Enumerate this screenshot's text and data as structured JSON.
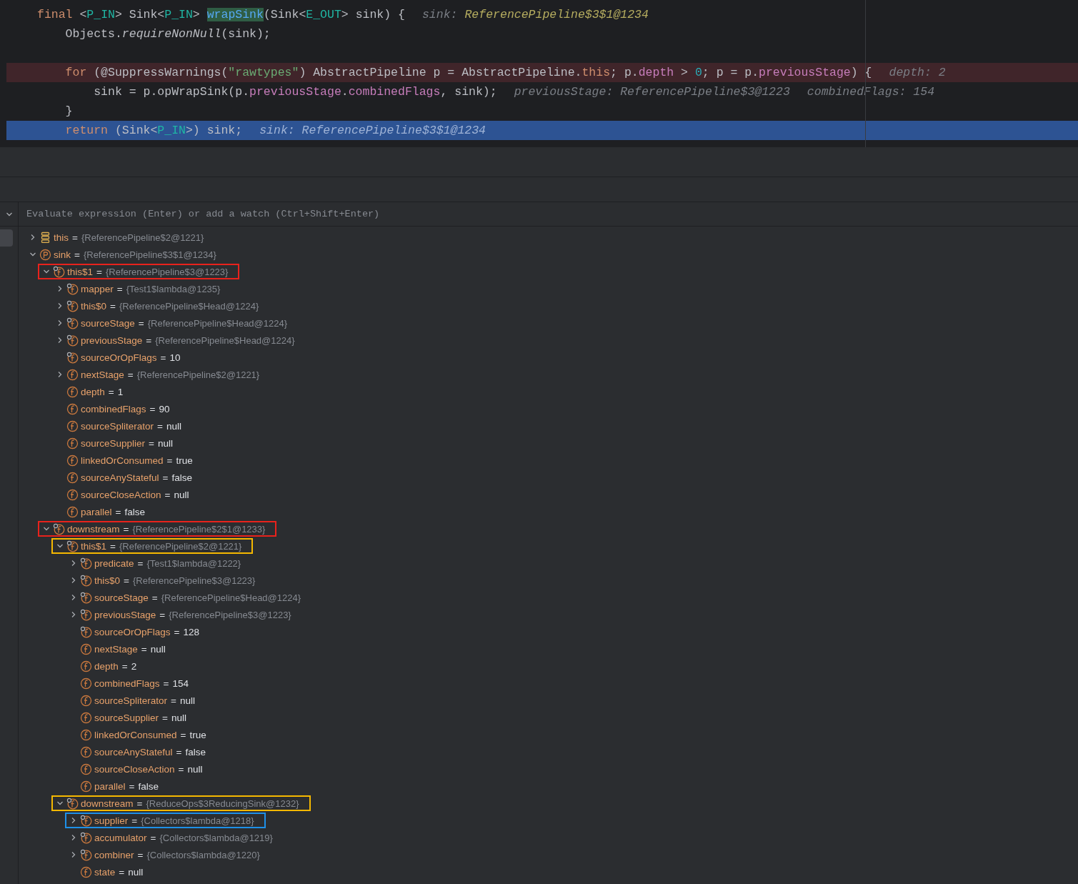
{
  "editor": {
    "lines": [
      {
        "kind": "none",
        "tokens": [
          {
            "kind": "keyword",
            "text": "final "
          },
          {
            "kind": "plain",
            "text": "<"
          },
          {
            "kind": "type-param",
            "text": "P_IN"
          },
          {
            "kind": "plain",
            "text": "> Sink<"
          },
          {
            "kind": "type-param",
            "text": "P_IN"
          },
          {
            "kind": "plain",
            "text": "> "
          },
          {
            "kind": "method-decl",
            "text": "wrapSink"
          },
          {
            "kind": "plain",
            "text": "(Sink<"
          },
          {
            "kind": "type-param",
            "text": "E_OUT"
          },
          {
            "kind": "plain",
            "text": "> sink) {"
          },
          {
            "kind": "hint",
            "text": "sink:"
          },
          {
            "kind": "hint-changed",
            "text": "ReferencePipeline$3$1@1234"
          }
        ]
      },
      {
        "kind": "none",
        "tokens": [
          {
            "kind": "plain",
            "text": "    Objects."
          },
          {
            "kind": "italic",
            "text": "requireNonNull"
          },
          {
            "kind": "plain",
            "text": "(sink);"
          }
        ]
      },
      {
        "kind": "none"
      },
      {
        "kind": "breakpoint",
        "tokens": [
          {
            "kind": "keyword",
            "text": "    for "
          },
          {
            "kind": "plain",
            "text": "(@SuppressWarnings("
          },
          {
            "kind": "string",
            "text": "\"rawtypes\""
          },
          {
            "kind": "plain",
            "text": ") AbstractPipeline p = AbstractPipeline."
          },
          {
            "kind": "keyword",
            "text": "this"
          },
          {
            "kind": "plain",
            "text": "; p."
          },
          {
            "kind": "field",
            "text": "depth"
          },
          {
            "kind": "plain",
            "text": " > "
          },
          {
            "kind": "number",
            "text": "0"
          },
          {
            "kind": "plain",
            "text": "; p = p."
          },
          {
            "kind": "field",
            "text": "previousStage"
          },
          {
            "kind": "plain",
            "text": ") {"
          },
          {
            "kind": "hint",
            "text": "depth: 2"
          }
        ]
      },
      {
        "kind": "none",
        "tokens": [
          {
            "kind": "plain",
            "text": "        sink = p.opWrapSink(p."
          },
          {
            "kind": "field",
            "text": "previousStage"
          },
          {
            "kind": "plain",
            "text": "."
          },
          {
            "kind": "field",
            "text": "combinedFlags"
          },
          {
            "kind": "plain",
            "text": ", sink);"
          },
          {
            "kind": "hint",
            "text": "previousStage: ReferencePipeline$3@1223"
          },
          {
            "kind": "hint",
            "text": "combinedFlags: 154"
          }
        ]
      },
      {
        "kind": "none",
        "tokens": [
          {
            "kind": "plain",
            "text": "    }"
          }
        ]
      },
      {
        "kind": "current",
        "tokens": [
          {
            "kind": "keyword",
            "text": "    return "
          },
          {
            "kind": "plain",
            "text": "(Sink<"
          },
          {
            "kind": "type-param",
            "text": "P_IN"
          },
          {
            "kind": "plain",
            "text": ">) sink;"
          },
          {
            "kind": "hint",
            "text": "sink: ReferencePipeline$3$1@1234"
          }
        ]
      }
    ]
  },
  "evaluate": {
    "placeholder": "Evaluate expression (Enter) or add a watch (Ctrl+Shift+Enter)"
  },
  "variables": [
    {
      "kind": "stack",
      "name": "this",
      "eq": "=",
      "value": "{ReferencePipeline$2@1221}",
      "expanded": false
    },
    {
      "kind": "parameter",
      "name": "sink",
      "eq": "=",
      "value": "{ReferencePipeline$3$1@1234}",
      "expanded": true,
      "children": [
        {
          "kind": "final-field",
          "name": "this$1",
          "eq": "=",
          "value": "{ReferencePipeline$3@1223}",
          "expanded": true,
          "color": "#e8221c",
          "children": [
            {
              "kind": "final-field",
              "name": "mapper",
              "eq": "=",
              "value": "{Test1$lambda@1235}",
              "expanded": false
            },
            {
              "kind": "final-field",
              "name": "this$0",
              "eq": "=",
              "value": "{ReferencePipeline$Head@1224}",
              "expanded": false
            },
            {
              "kind": "final-field",
              "name": "sourceStage",
              "eq": "=",
              "value": "{ReferencePipeline$Head@1224}",
              "expanded": false
            },
            {
              "kind": "final-field",
              "name": "previousStage",
              "eq": "=",
              "value": "{ReferencePipeline$Head@1224}",
              "expanded": false
            },
            {
              "kind": "final-field",
              "name": "sourceOrOpFlags",
              "eq": "=",
              "value": "10"
            },
            {
              "kind": "field",
              "name": "nextStage",
              "eq": "=",
              "value": "{ReferencePipeline$2@1221}",
              "expanded": false
            },
            {
              "kind": "field",
              "name": "depth",
              "eq": "=",
              "value": "1"
            },
            {
              "kind": "field",
              "name": "combinedFlags",
              "eq": "=",
              "value": "90"
            },
            {
              "kind": "field",
              "name": "sourceSpliterator",
              "eq": "=",
              "value": "null"
            },
            {
              "kind": "field",
              "name": "sourceSupplier",
              "eq": "=",
              "value": "null"
            },
            {
              "kind": "field",
              "name": "linkedOrConsumed",
              "eq": "=",
              "value": "true"
            },
            {
              "kind": "field",
              "name": "sourceAnyStateful",
              "eq": "=",
              "value": "false"
            },
            {
              "kind": "field",
              "name": "sourceCloseAction",
              "eq": "=",
              "value": "null"
            },
            {
              "kind": "field",
              "name": "parallel",
              "eq": "=",
              "value": "false"
            }
          ]
        },
        {
          "kind": "final-field",
          "name": "downstream",
          "eq": "=",
          "value": "{ReferencePipeline$2$1@1233}",
          "expanded": true,
          "color": "#e8221c",
          "children": [
            {
              "kind": "final-field",
              "name": "this$1",
              "eq": "=",
              "value": "{ReferencePipeline$2@1221}",
              "expanded": true,
              "color": "#f5b800",
              "children": [
                {
                  "kind": "final-field",
                  "name": "predicate",
                  "eq": "=",
                  "value": "{Test1$lambda@1222}",
                  "expanded": false
                },
                {
                  "kind": "final-field",
                  "name": "this$0",
                  "eq": "=",
                  "value": "{ReferencePipeline$3@1223}",
                  "expanded": false
                },
                {
                  "kind": "final-field",
                  "name": "sourceStage",
                  "eq": "=",
                  "value": "{ReferencePipeline$Head@1224}",
                  "expanded": false
                },
                {
                  "kind": "final-field",
                  "name": "previousStage",
                  "eq": "=",
                  "value": "{ReferencePipeline$3@1223}",
                  "expanded": false
                },
                {
                  "kind": "final-field",
                  "name": "sourceOrOpFlags",
                  "eq": "=",
                  "value": "128"
                },
                {
                  "kind": "field",
                  "name": "nextStage",
                  "eq": "=",
                  "value": "null"
                },
                {
                  "kind": "field",
                  "name": "depth",
                  "eq": "=",
                  "value": "2"
                },
                {
                  "kind": "field",
                  "name": "combinedFlags",
                  "eq": "=",
                  "value": "154"
                },
                {
                  "kind": "field",
                  "name": "sourceSpliterator",
                  "eq": "=",
                  "value": "null"
                },
                {
                  "kind": "field",
                  "name": "sourceSupplier",
                  "eq": "=",
                  "value": "null"
                },
                {
                  "kind": "field",
                  "name": "linkedOrConsumed",
                  "eq": "=",
                  "value": "true"
                },
                {
                  "kind": "field",
                  "name": "sourceAnyStateful",
                  "eq": "=",
                  "value": "false"
                },
                {
                  "kind": "field",
                  "name": "sourceCloseAction",
                  "eq": "=",
                  "value": "null"
                },
                {
                  "kind": "field",
                  "name": "parallel",
                  "eq": "=",
                  "value": "false"
                }
              ]
            },
            {
              "kind": "final-field",
              "name": "downstream",
              "eq": "=",
              "value": "{ReduceOps$3ReducingSink@1232}",
              "expanded": true,
              "color": "#f5b800",
              "children": [
                {
                  "kind": "final-field",
                  "name": "supplier",
                  "eq": "=",
                  "value": "{Collectors$lambda@1218}",
                  "expanded": false,
                  "color": "#1e90e8"
                },
                {
                  "kind": "final-field",
                  "name": "accumulator",
                  "eq": "=",
                  "value": "{Collectors$lambda@1219}",
                  "expanded": false
                },
                {
                  "kind": "final-field",
                  "name": "combiner",
                  "eq": "=",
                  "value": "{Collectors$lambda@1220}",
                  "expanded": false
                },
                {
                  "kind": "field",
                  "name": "state",
                  "eq": "=",
                  "value": "null"
                }
              ]
            }
          ]
        }
      ]
    }
  ]
}
